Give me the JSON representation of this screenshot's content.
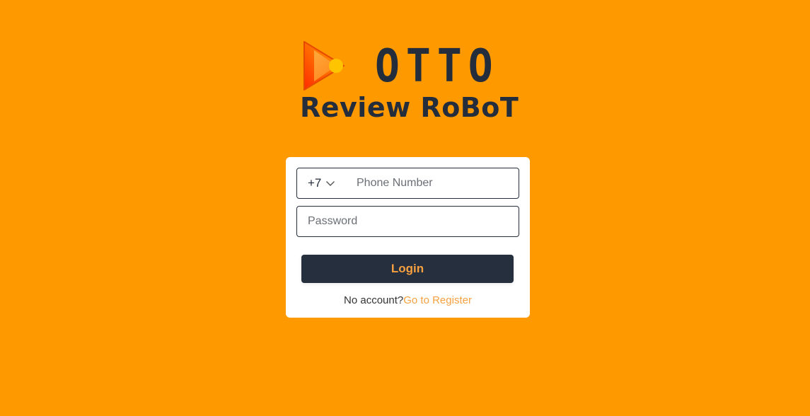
{
  "logo": {
    "brand": "OTTO",
    "subtitle": "Review RoBoT",
    "icon": "play-icon",
    "colors": {
      "dark": "#232D3B",
      "gradient_start": "#FF4A00",
      "gradient_end": "#FFC400"
    }
  },
  "form": {
    "country_code": "+7",
    "phone_placeholder": "Phone Number",
    "password_placeholder": "Password",
    "login_label": "Login",
    "no_account_text": "No account?",
    "register_link": "Go to Register"
  },
  "colors": {
    "background": "#FF9900",
    "card": "#FFFFFF",
    "button": "#252F3E",
    "accent": "#F7A040"
  }
}
